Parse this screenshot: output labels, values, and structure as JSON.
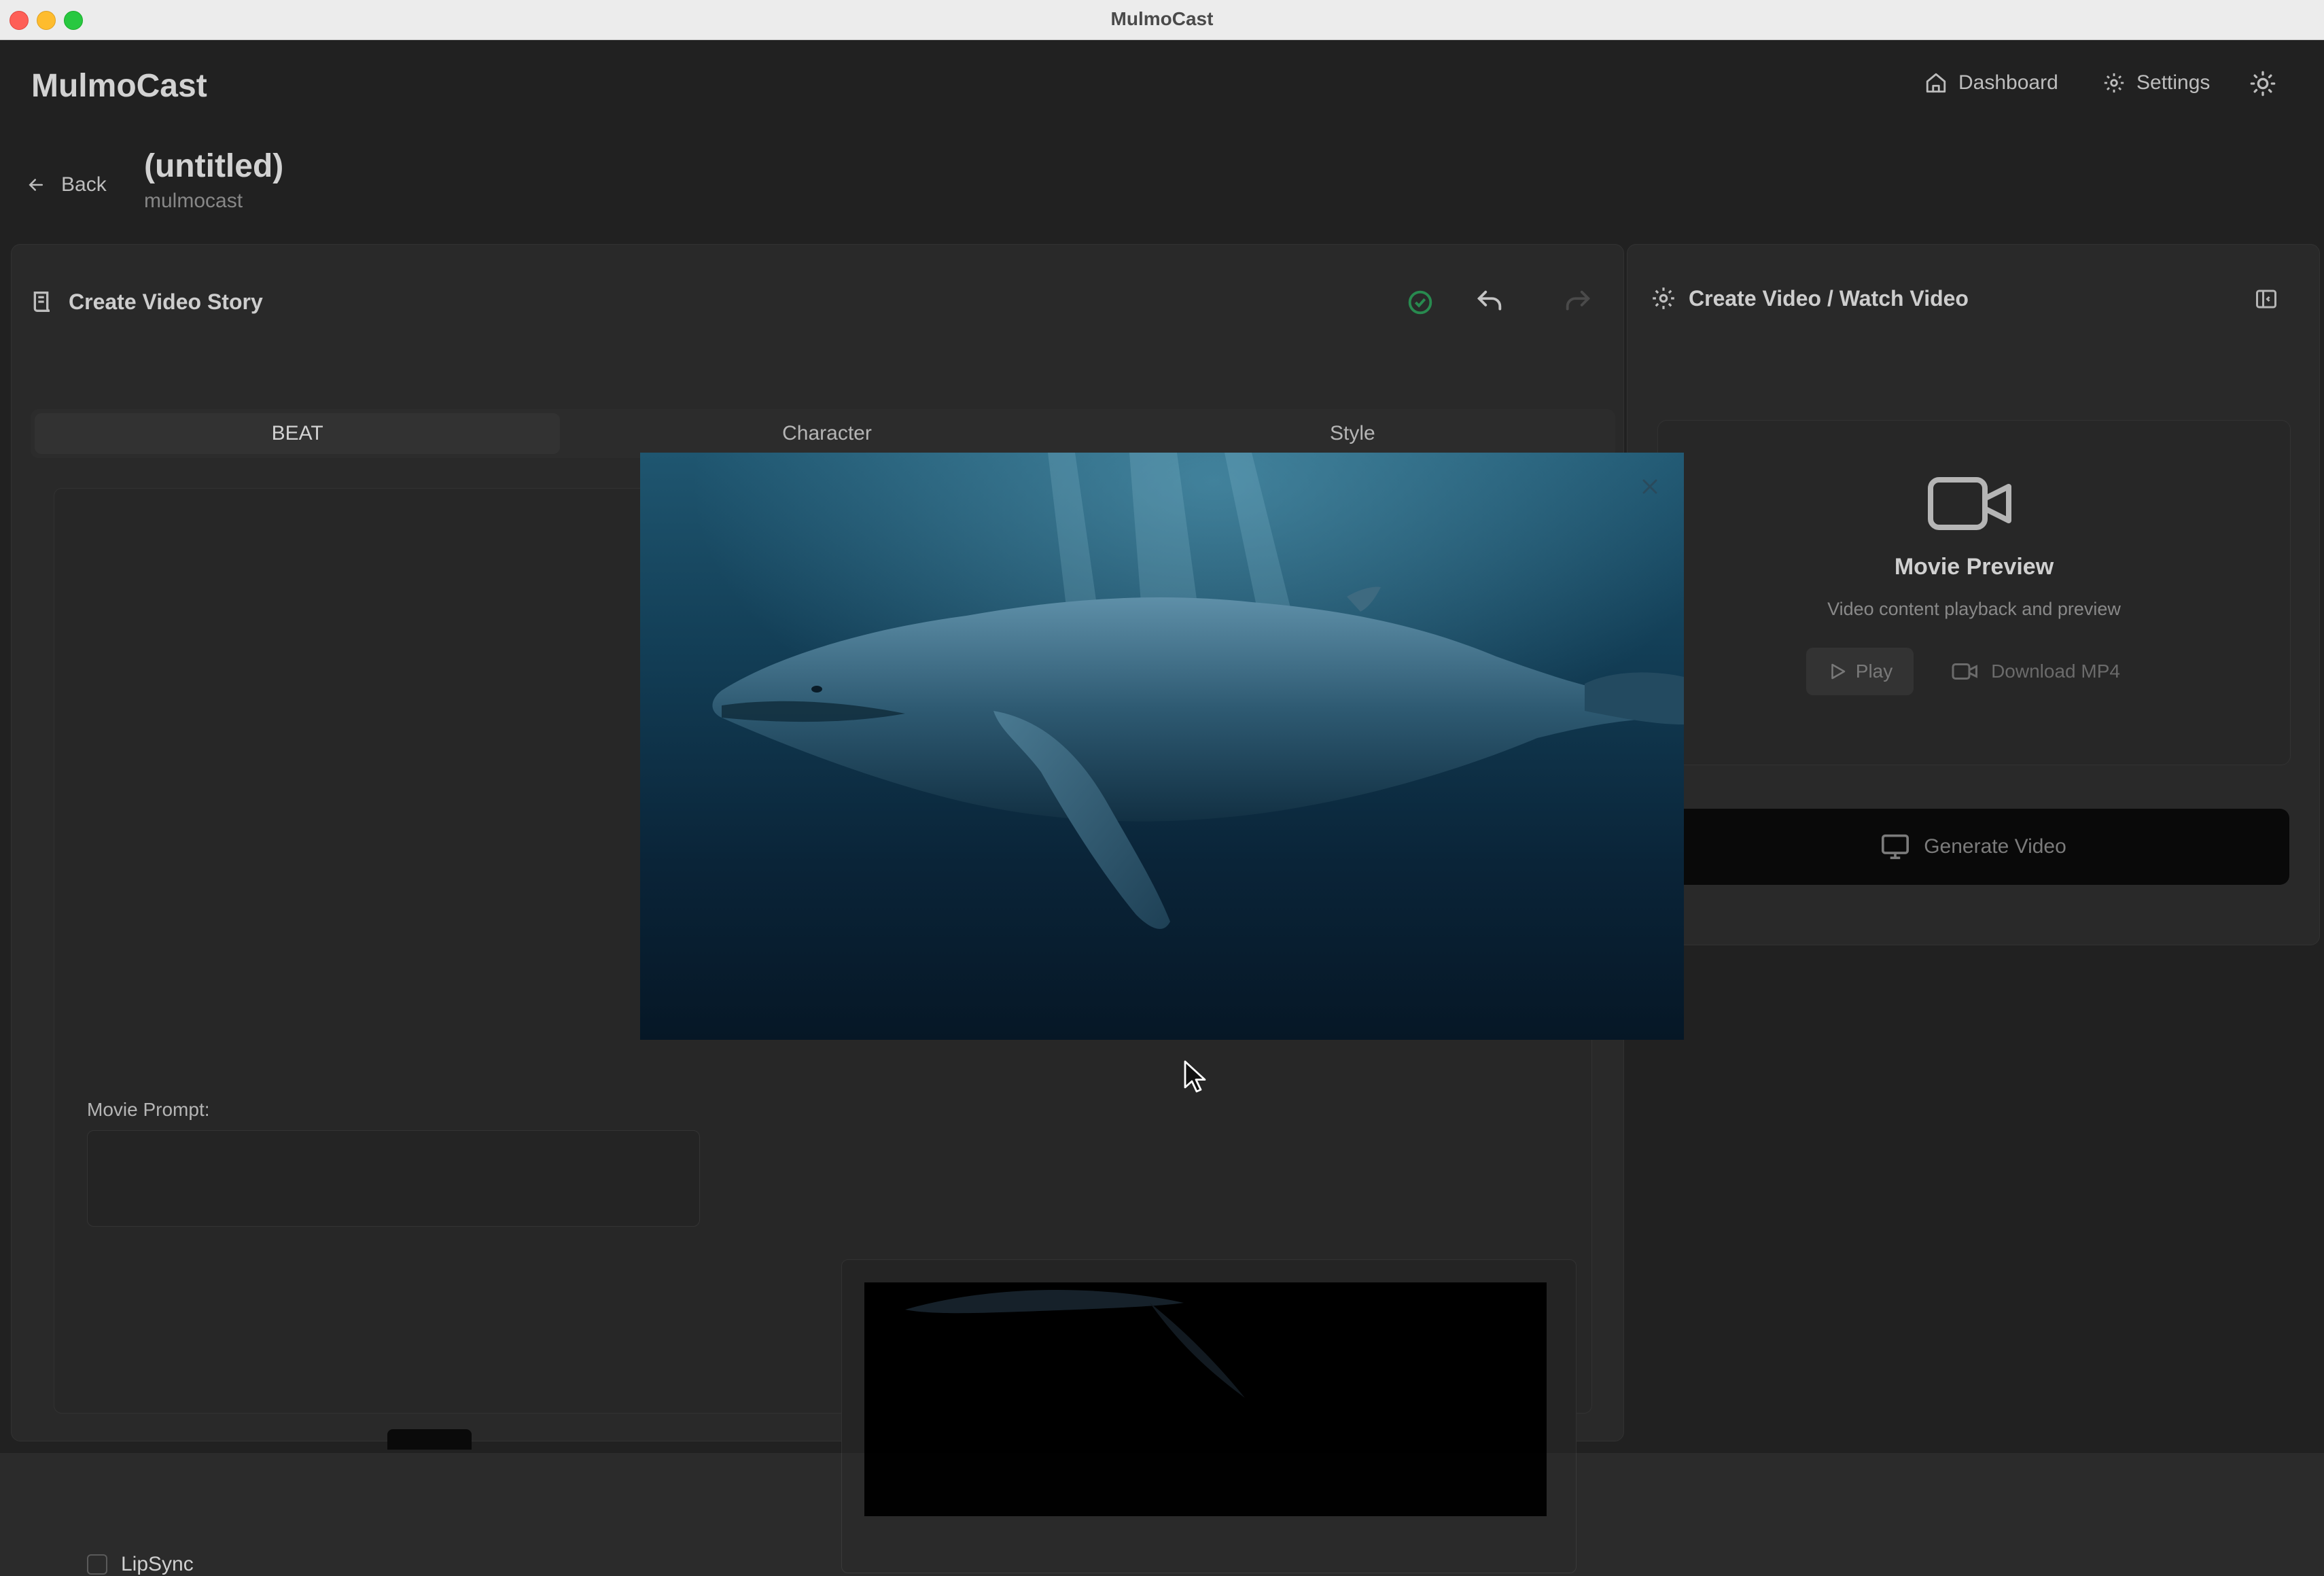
{
  "window": {
    "title": "MulmoCast"
  },
  "header": {
    "brand": "MulmoCast",
    "nav": [
      {
        "label": "Dashboard",
        "icon": "home-icon"
      },
      {
        "label": "Settings",
        "icon": "gear-icon"
      }
    ],
    "theme_icon": "sun-icon"
  },
  "page": {
    "back_label": "Back",
    "title": "(untitled)",
    "subtitle": "mulmocast"
  },
  "editor": {
    "heading": "Create Video Story",
    "icons": [
      "saved-check-icon",
      "undo-icon",
      "redo-icon"
    ],
    "tabs": [
      {
        "label": "BEAT",
        "active": true
      },
      {
        "label": "Character",
        "active": false
      },
      {
        "label": "Style",
        "active": false
      }
    ],
    "movie_prompt_label": "Movie Prompt:",
    "lipsync_label": "LipSync",
    "lipsync_checked": false
  },
  "output": {
    "heading": "Create Video / Watch Video",
    "preview_title": "Movie Preview",
    "preview_subtitle": "Video content playback and preview",
    "play_label": "Play",
    "download_label": "Download MP4",
    "generate_label": "Generate Video"
  },
  "modal": {
    "image_subject": "humpback whale underwater",
    "close_icon": "close-icon"
  },
  "colors": {
    "background": "#262626",
    "card": "#2f2f2f",
    "accent_success": "#2e9e5b",
    "generate_button": "#0b0b0b"
  }
}
